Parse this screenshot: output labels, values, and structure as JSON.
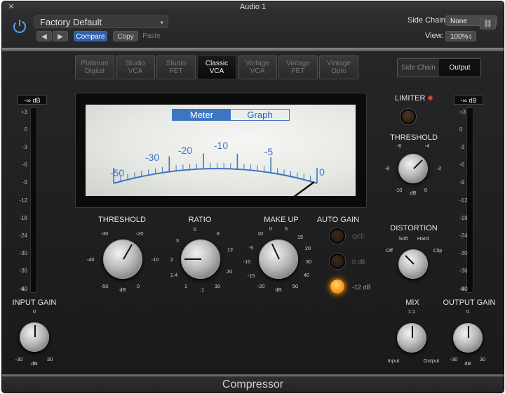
{
  "window": {
    "title": "Audio 1"
  },
  "toolbar": {
    "preset": "Factory Default",
    "prev_label": "◀",
    "next_label": "▶",
    "compare_label": "Compare",
    "copy_label": "Copy",
    "paste_label": "Paste",
    "sidechain_label": "Side Chain:",
    "sidechain_value": "None",
    "view_label": "View:",
    "view_value": "100%"
  },
  "models": [
    {
      "line1": "Platinum",
      "line2": "Digital"
    },
    {
      "line1": "Studio",
      "line2": "VCA"
    },
    {
      "line1": "Studio",
      "line2": "FET"
    },
    {
      "line1": "Classic",
      "line2": "VCA"
    },
    {
      "line1": "Vintage",
      "line2": "VCA"
    },
    {
      "line1": "Vintage",
      "line2": "FET"
    },
    {
      "line1": "Vintage",
      "line2": "Opto"
    }
  ],
  "active_model": "Classic VCA",
  "view_switch": {
    "sidechain": "Side Chain",
    "output": "Output",
    "active": "Output"
  },
  "meter": {
    "tab_meter": "Meter",
    "tab_graph": "Graph",
    "active_tab": "Meter",
    "scale": [
      "-50",
      "-30",
      "-20",
      "-10",
      "-5",
      "0"
    ],
    "accent": "#3e74c4"
  },
  "input_meter": {
    "readout": "-∞ dB"
  },
  "output_meter": {
    "readout": "-∞ dB"
  },
  "meter_scale": [
    "+3",
    "0",
    "-3",
    "-6",
    "-9",
    "-12",
    "-18",
    "-24",
    "-30",
    "-36",
    "-40",
    "-60"
  ],
  "threshold": {
    "label": "THRESHOLD",
    "ticks": [
      "-30",
      "-20",
      "-40",
      "-10",
      "-50",
      "0"
    ],
    "unit": "dB"
  },
  "ratio": {
    "label": "RATIO",
    "ticks": [
      "5",
      "3",
      "8",
      "2",
      "12",
      "1.4",
      "20",
      "1",
      "30"
    ],
    "unit": ":1"
  },
  "makeup": {
    "label": "MAKE UP",
    "ticks": [
      "0",
      "5",
      "10",
      "-5",
      "15",
      "20",
      "-10",
      "30",
      "-15",
      "40",
      "-20",
      "50"
    ],
    "unit": "dB"
  },
  "auto_gain": {
    "label": "AUTO GAIN",
    "options": [
      "OFF",
      "0 dB",
      "-12 dB"
    ],
    "selected": "-12 dB",
    "led_color": "#ff9a1f"
  },
  "input_gain": {
    "label": "INPUT GAIN",
    "ticks": [
      "0",
      "-30",
      "30"
    ],
    "unit": "dB"
  },
  "limiter": {
    "label": "LIMITER"
  },
  "limiter_threshold": {
    "label": "THRESHOLD",
    "ticks": [
      "-6",
      "-4",
      "-8",
      "-2",
      "-10",
      "0"
    ],
    "unit": "dB"
  },
  "distortion": {
    "label": "DISTORTION",
    "ticks": [
      "Soft",
      "Hard",
      "Off",
      "Clip"
    ]
  },
  "mix": {
    "label": "MIX",
    "ticks": [
      "1:1",
      "Input",
      "Output"
    ]
  },
  "output_gain": {
    "label": "OUTPUT GAIN",
    "ticks": [
      "0",
      "-30",
      "30"
    ],
    "unit": "dB"
  },
  "footer": {
    "title": "Compressor"
  }
}
